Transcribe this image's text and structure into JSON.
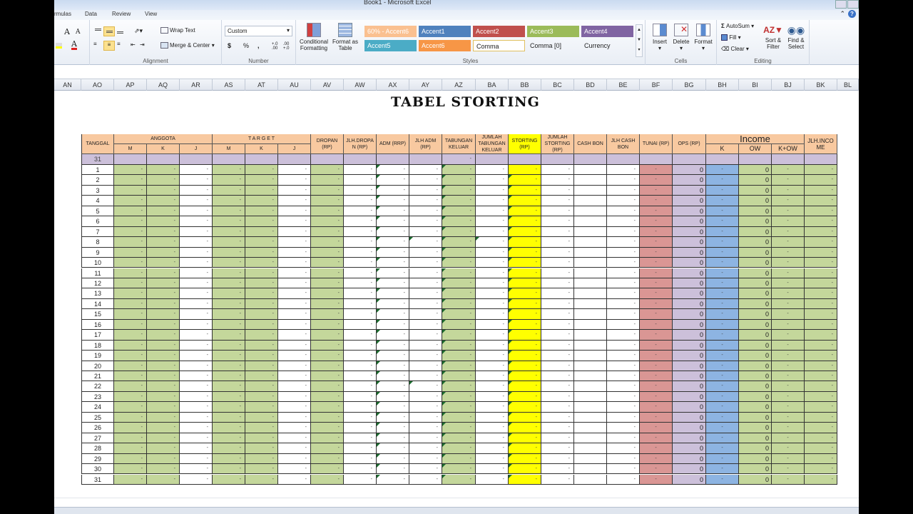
{
  "window": {
    "title": "Book1 - Microsoft Excel"
  },
  "ribbon_tabs": [
    "rmulas",
    "Data",
    "Review",
    "View"
  ],
  "ribbon": {
    "font_group": {
      "grow_font": "A",
      "shrink_font": "A",
      "font_color": "A"
    },
    "alignment": {
      "label": "Alignment",
      "wrap_text": "Wrap Text",
      "merge_center": "Merge & Center"
    },
    "number": {
      "label": "Number",
      "format_value": "Custom",
      "currency": "$",
      "percent": "%",
      "comma": ",",
      "inc_decimal": "+.0 .00",
      "dec_decimal": ".00 →.0"
    },
    "styles": {
      "label": "Styles",
      "conditional_formatting": "Conditional Formatting",
      "format_as_table": "Format as Table",
      "cells": [
        {
          "label": "60% - Accent6",
          "bg": "#fac090",
          "fg": "#ffffff"
        },
        {
          "label": "Accent1",
          "bg": "#4f81bd",
          "fg": "#ffffff"
        },
        {
          "label": "Accent2",
          "bg": "#c0504d",
          "fg": "#ffffff"
        },
        {
          "label": "Accent3",
          "bg": "#9bbb59",
          "fg": "#ffffff"
        },
        {
          "label": "Accent4",
          "bg": "#8064a2",
          "fg": "#ffffff"
        },
        {
          "label": "Accent5",
          "bg": "#4bacc6",
          "fg": "#ffffff"
        },
        {
          "label": "Accent6",
          "bg": "#f79646",
          "fg": "#ffffff"
        },
        {
          "label": "Comma",
          "bg": "#ffffff",
          "fg": "#222222"
        },
        {
          "label": "Comma [0]",
          "bg": "transparent",
          "fg": "#222222"
        },
        {
          "label": "Currency",
          "bg": "transparent",
          "fg": "#222222"
        }
      ]
    },
    "cells_group": {
      "label": "Cells",
      "insert": "Insert",
      "delete": "Delete",
      "format": "Format"
    },
    "editing": {
      "label": "Editing",
      "autosum": "AutoSum",
      "fill": "Fill",
      "clear": "Clear",
      "sort_filter": "Sort & Filter",
      "find_select": "Find & Select"
    }
  },
  "columns": [
    "AN",
    "AO",
    "AP",
    "AQ",
    "AR",
    "AS",
    "AT",
    "AU",
    "AV",
    "AW",
    "AX",
    "AY",
    "AZ",
    "BA",
    "BB",
    "BC",
    "BD",
    "BE",
    "BF",
    "BG",
    "BH",
    "BI",
    "BJ",
    "BK",
    "BL"
  ],
  "sheet": {
    "title": "TABEL STORTING",
    "headers": {
      "tanggal": "TANGGAL",
      "anggota": "ANGGOTA",
      "target": "T A R G E T",
      "sub_mkj": [
        "M",
        "K",
        "J"
      ],
      "dropan": "DROPAN (RP)",
      "jlh_dropan": "JLH.DROPA N (RP)",
      "adm": "ADM (RRP)",
      "jlh_adm": "JLH ADM (RP)",
      "tabungan_keluar": "TABUNGAN KELUAR",
      "jumlah_tabungan_keluar": "JUMLAH TABUNGAN KELUAR",
      "storting": "STORTING (RP)",
      "jumlah_storting": "JUMLAH STORTING (RP)",
      "cash_bon": "CASH BON",
      "jlh_cash_bon": "JLH CASH BON",
      "tunai": "TUNAI (RP)",
      "ops": "OPS (RP)",
      "income": "Income",
      "income_sub": [
        "K",
        "OW",
        "K+OW"
      ],
      "jlh_income": "JLH.INCO ME"
    },
    "summary_row": {
      "label": "31",
      "tabungan_keluar": "-"
    },
    "row_count": 31,
    "cell_values": {
      "dash": "-",
      "zero": "0"
    },
    "colors": {
      "header": "#f8c9a0",
      "green": "#c4d79b",
      "yellow": "#ffff00",
      "red": "#da9694",
      "lavender": "#ccc0da",
      "blue": "#8db4e2",
      "summary": "#ccc0da"
    }
  }
}
